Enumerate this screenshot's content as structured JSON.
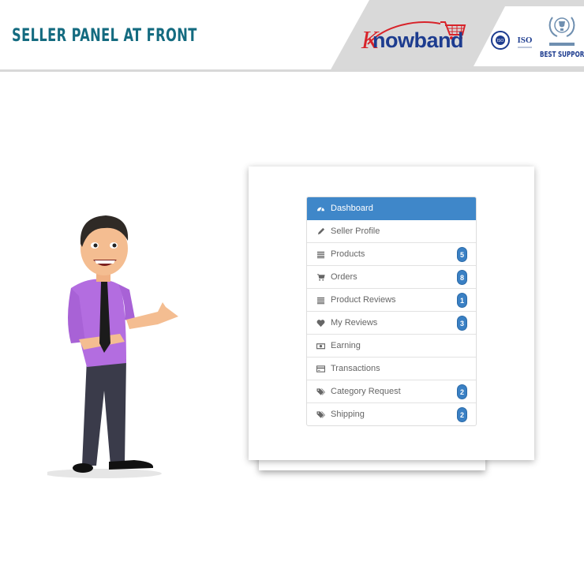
{
  "banner": {
    "title": "SELLER PANEL AT FRONT",
    "brand": "nowband",
    "brand_initial": "K",
    "certifications": [
      "ISO certified seal",
      "ISO"
    ],
    "support_badge": "BEST SUPPORT"
  },
  "colors": {
    "title": "#146b80",
    "active_item": "#3f87c9",
    "badge": "#3a80c4",
    "brand_blue": "#1d3c8f",
    "brand_red": "#d8232a"
  },
  "menu": {
    "items": [
      {
        "label": "Dashboard",
        "icon": "dashboard-icon",
        "active": true,
        "count": null
      },
      {
        "label": "Seller Profile",
        "icon": "pencil-icon",
        "active": false,
        "count": null
      },
      {
        "label": "Products",
        "icon": "list-icon",
        "active": false,
        "count": "5"
      },
      {
        "label": "Orders",
        "icon": "cart-icon",
        "active": false,
        "count": "8"
      },
      {
        "label": "Product Reviews",
        "icon": "list-icon",
        "active": false,
        "count": "1"
      },
      {
        "label": "My Reviews",
        "icon": "heart-icon",
        "active": false,
        "count": "3"
      },
      {
        "label": "Earning",
        "icon": "money-icon",
        "active": false,
        "count": null
      },
      {
        "label": "Transactions",
        "icon": "credit-card-icon",
        "active": false,
        "count": null
      },
      {
        "label": "Category Request",
        "icon": "tags-icon",
        "active": false,
        "count": "2"
      },
      {
        "label": "Shipping",
        "icon": "tags-icon",
        "active": false,
        "count": "2"
      }
    ]
  }
}
